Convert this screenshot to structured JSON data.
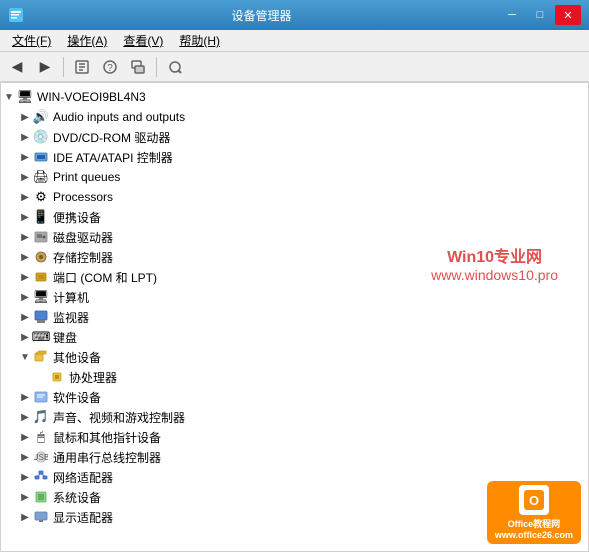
{
  "titleBar": {
    "title": "设备管理器",
    "minBtn": "─",
    "maxBtn": "□",
    "closeBtn": "✕"
  },
  "menuBar": {
    "items": [
      {
        "label": "文件(F)",
        "underlineChar": "F"
      },
      {
        "label": "操作(A)",
        "underlineChar": "A"
      },
      {
        "label": "查看(V)",
        "underlineChar": "V"
      },
      {
        "label": "帮助(H)",
        "underlineChar": "H"
      }
    ]
  },
  "tree": {
    "rootNode": "WIN-VOEOI9BL4N3",
    "items": [
      {
        "id": "audio",
        "label": "Audio inputs and outputs",
        "indent": 2,
        "icon": "🔊",
        "expanded": false
      },
      {
        "id": "dvd",
        "label": "DVD/CD-ROM 驱动器",
        "indent": 2,
        "icon": "💿",
        "expanded": false
      },
      {
        "id": "ide",
        "label": "IDE ATA/ATAPI 控制器",
        "indent": 2,
        "icon": "🖥",
        "expanded": false
      },
      {
        "id": "print",
        "label": "Print queues",
        "indent": 2,
        "icon": "🖨",
        "expanded": false
      },
      {
        "id": "proc",
        "label": "Processors",
        "indent": 2,
        "icon": "⚙",
        "expanded": false
      },
      {
        "id": "portable",
        "label": "便携设备",
        "indent": 2,
        "icon": "📱",
        "expanded": false
      },
      {
        "id": "disk",
        "label": "磁盘驱动器",
        "indent": 2,
        "icon": "💾",
        "expanded": false
      },
      {
        "id": "storage",
        "label": "存储控制器",
        "indent": 2,
        "icon": "🗂",
        "expanded": false
      },
      {
        "id": "port",
        "label": "端口 (COM 和 LPT)",
        "indent": 2,
        "icon": "🔌",
        "expanded": false
      },
      {
        "id": "computer",
        "label": "计算机",
        "indent": 2,
        "icon": "🖥",
        "expanded": false
      },
      {
        "id": "monitor",
        "label": "监视器",
        "indent": 2,
        "icon": "🖥",
        "expanded": false
      },
      {
        "id": "keyboard",
        "label": "键盘",
        "indent": 2,
        "icon": "⌨",
        "expanded": false
      },
      {
        "id": "other",
        "label": "其他设备",
        "indent": 2,
        "icon": "📁",
        "expanded": true
      },
      {
        "id": "coprocessor",
        "label": "协处理器",
        "indent": 3,
        "icon": "⚙",
        "expanded": false
      },
      {
        "id": "software",
        "label": "软件设备",
        "indent": 2,
        "icon": "📋",
        "expanded": false
      },
      {
        "id": "sound",
        "label": "声音、视频和游戏控制器",
        "indent": 2,
        "icon": "🎵",
        "expanded": false
      },
      {
        "id": "mouse",
        "label": "鼠标和其他指针设备",
        "indent": 2,
        "icon": "🖱",
        "expanded": false
      },
      {
        "id": "usb",
        "label": "通用串行总线控制器",
        "indent": 2,
        "icon": "🔌",
        "expanded": false
      },
      {
        "id": "network",
        "label": "网络适配器",
        "indent": 2,
        "icon": "🌐",
        "expanded": false
      },
      {
        "id": "system",
        "label": "系统设备",
        "indent": 2,
        "icon": "⚙",
        "expanded": false
      },
      {
        "id": "display",
        "label": "显示适配器",
        "indent": 2,
        "icon": "🖥",
        "expanded": false
      }
    ]
  },
  "watermark": {
    "line1": "Win10专业网",
    "line2": "www.windows10.pro"
  },
  "officeBadge": {
    "line1": "Office教程网",
    "line2": "www.office26.com"
  }
}
